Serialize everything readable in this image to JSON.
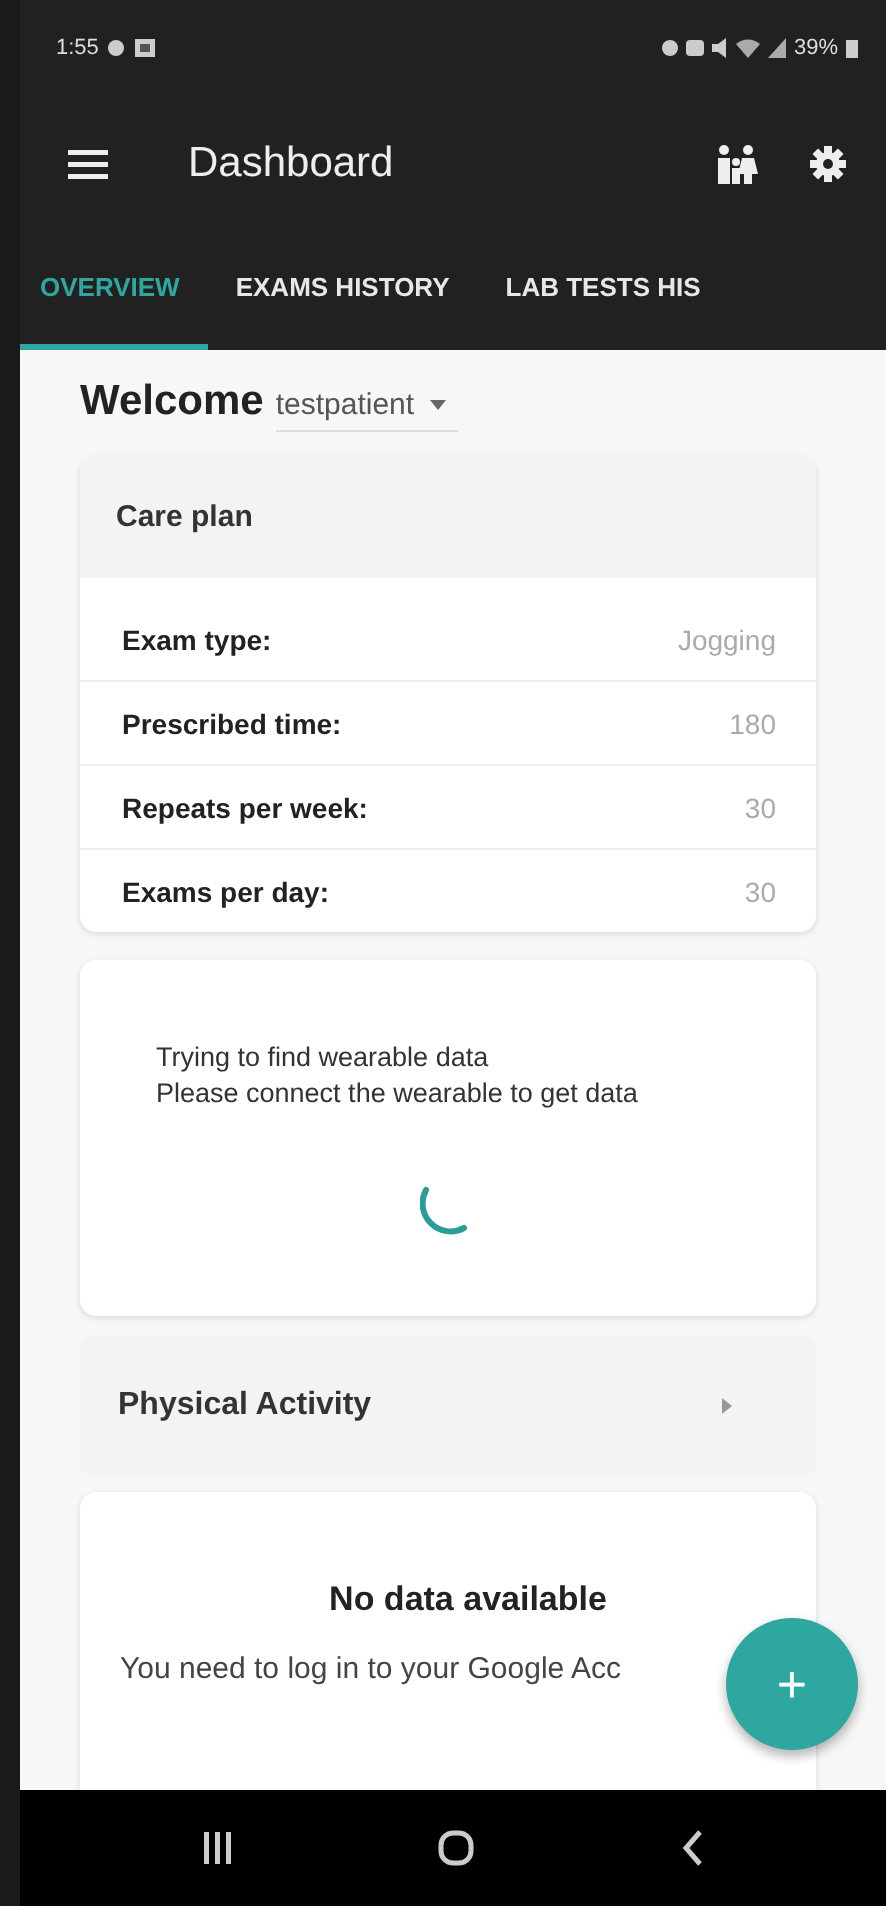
{
  "status_bar": {
    "time": "1:55",
    "battery": "39%"
  },
  "app_bar": {
    "title": "Dashboard"
  },
  "tabs": [
    {
      "label": "OVERVIEW",
      "selected": true
    },
    {
      "label": "EXAMS HISTORY",
      "selected": false
    },
    {
      "label": "LAB TESTS HIS",
      "selected": false
    }
  ],
  "welcome": {
    "label": "Welcome",
    "user": "testpatient"
  },
  "care_plan": {
    "title": "Care plan",
    "rows": [
      {
        "label": "Exam type:",
        "value": "Jogging"
      },
      {
        "label": "Prescribed time:",
        "value": "180"
      },
      {
        "label": "Repeats per week:",
        "value": "30"
      },
      {
        "label": "Exams per day:",
        "value": "30"
      }
    ]
  },
  "wearable": {
    "message": "Trying to find wearable data\nPlease connect the wearable to get data",
    "loading": true
  },
  "physical_activity": {
    "title": "Physical Activity",
    "expanded": false
  },
  "no_data": {
    "title": "No data available",
    "message": "You need to log in to your Google Acc"
  },
  "fab": {
    "label": "+"
  }
}
